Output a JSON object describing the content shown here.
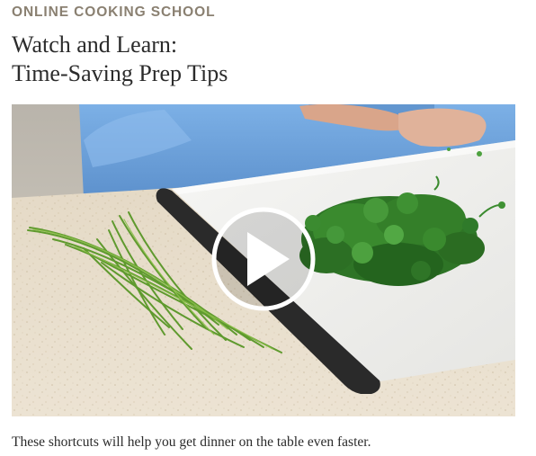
{
  "header": {
    "eyebrow": "ONLINE COOKING SCHOOL",
    "title_line1": "Watch and Learn:",
    "title_line2": "Time-Saving Prep Tips"
  },
  "video": {
    "thumbnail_subject": "hands chopping parsley and chives on a white cutting board",
    "play_icon": "play-icon"
  },
  "caption": "These shortcuts will help you get dinner on the table even faster.",
  "colors": {
    "eyebrow": "#8a8071",
    "heading_text": "#2b2b2b",
    "countertop": "#e7dcc9",
    "cutting_board": "#f1f1ef",
    "board_edge": "#2a2a2a",
    "shirt": "#6a9fd8",
    "herb": "#2f7a2a"
  }
}
